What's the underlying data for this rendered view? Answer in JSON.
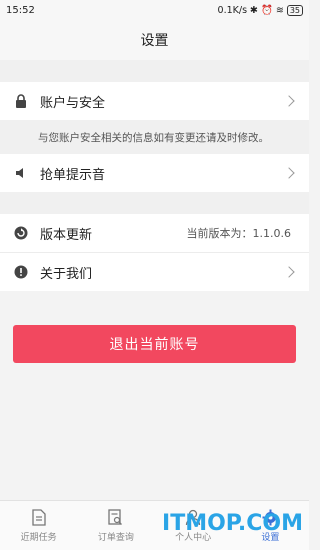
{
  "status": {
    "time": "15:52",
    "network": "0.1K/s",
    "battery": "35"
  },
  "header": {
    "title": "设置"
  },
  "settings": {
    "account": {
      "label": "账户与安全",
      "note": "与您账户安全相关的信息如有变更还请及时修改。"
    },
    "sound": {
      "label": "抢单提示音"
    },
    "version": {
      "label": "版本更新",
      "value": "当前版本为：1.1.0.6"
    },
    "about": {
      "label": "关于我们"
    }
  },
  "logout_label": "退出当前账号",
  "tabs": [
    {
      "label": "近期任务",
      "icon": "document-icon"
    },
    {
      "label": "订单查询",
      "icon": "order-search-icon"
    },
    {
      "label": "个人中心",
      "icon": "person-icon"
    },
    {
      "label": "设置",
      "icon": "gear-icon"
    }
  ],
  "active_tab": "设置",
  "watermark": "ITMOP.COM",
  "colors": {
    "accent": "#f2485f",
    "active_tab": "#3b6fd6"
  }
}
